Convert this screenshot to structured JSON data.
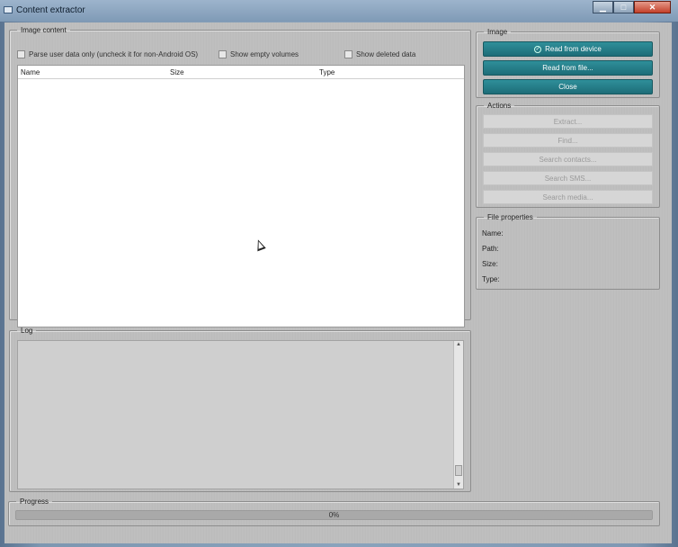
{
  "window": {
    "title": "Content extractor",
    "buttons": {
      "minimize": "▁",
      "maximize": "□",
      "close": "✕"
    }
  },
  "image_content": {
    "legend": "Image content",
    "checkboxes": [
      {
        "label": "Parse user data only (uncheck it for non-Android OS)",
        "checked": false
      },
      {
        "label": "Show empty volumes",
        "checked": false
      },
      {
        "label": "Show deleted data",
        "checked": false
      }
    ],
    "columns": [
      "Name",
      "Size",
      "Type"
    ]
  },
  "log": {
    "legend": "Log"
  },
  "image_group": {
    "legend": "Image",
    "read_from_device": "Read from device",
    "read_from_file": "Read from file...",
    "close": "Close"
  },
  "actions": {
    "legend": "Actions",
    "items": [
      "Extract...",
      "Find...",
      "Search contacts...",
      "Search SMS...",
      "Search media..."
    ]
  },
  "file_properties": {
    "legend": "File properties",
    "labels": [
      "Name:",
      "Path:",
      "Size:",
      "Type:"
    ]
  },
  "progress": {
    "legend": "Progress",
    "value_text": "0%",
    "value": 0
  },
  "colors": {
    "accent": "#1f7a85",
    "titlebar": "#8aa3bc",
    "panel": "#bdbdbd"
  },
  "icons": {
    "read_from_device": "check-circle-icon"
  }
}
